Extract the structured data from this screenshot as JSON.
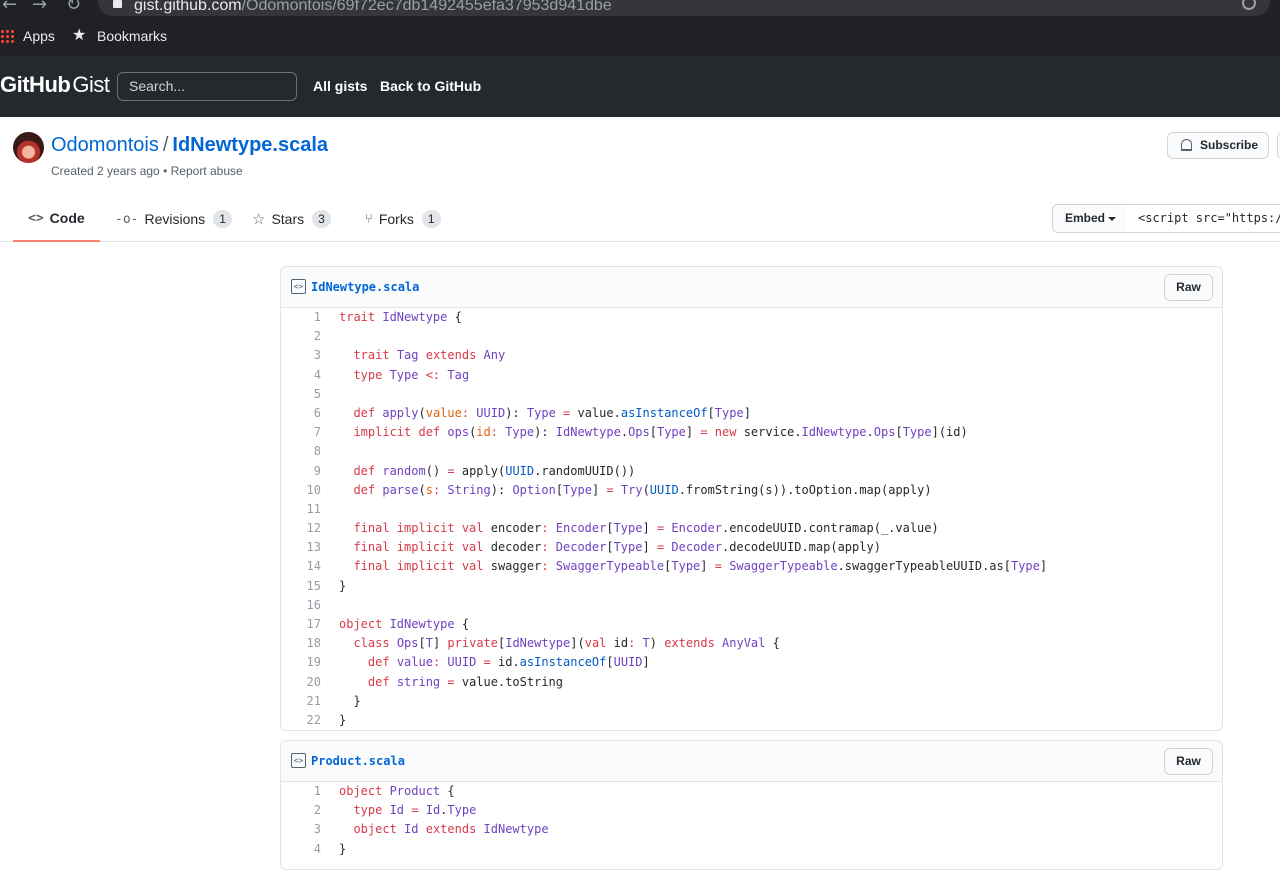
{
  "browser": {
    "url_host": "gist.github.com",
    "url_path": "/Odomontois/69f72ec7db1492455efa37953d941dbe",
    "bookmarks": {
      "apps": "Apps",
      "bookmarks": "Bookmarks"
    }
  },
  "header": {
    "logo_bold": "GitHub",
    "logo_light": "Gist",
    "search_placeholder": "Search...",
    "links": [
      "All gists",
      "Back to GitHub"
    ]
  },
  "gist": {
    "owner": "Odomontois",
    "separator": "/",
    "filename": "IdNewtype.scala",
    "created": "Created 2 years ago",
    "dot": "•",
    "report": "Report abuse",
    "subscribe": "Subscribe"
  },
  "tabs": {
    "code": "Code",
    "revisions": "Revisions",
    "revisions_count": "1",
    "stars": "Stars",
    "stars_count": "3",
    "forks": "Forks",
    "forks_count": "1",
    "embed": "Embed",
    "embed_value": "<script src=\"https://"
  },
  "files": [
    {
      "name": "IdNewtype.scala",
      "raw": "Raw",
      "lines": [
        [
          [
            "k",
            "trait "
          ],
          [
            "t",
            "IdNewtype"
          ],
          [
            "p",
            " {"
          ]
        ],
        [],
        [
          [
            "p",
            "  "
          ],
          [
            "k",
            "trait "
          ],
          [
            "t",
            "Tag "
          ],
          [
            "k",
            "extends "
          ],
          [
            "t",
            "Any"
          ]
        ],
        [
          [
            "p",
            "  "
          ],
          [
            "k",
            "type "
          ],
          [
            "t",
            "Type "
          ],
          [
            "k",
            "<: "
          ],
          [
            "t",
            "Tag"
          ]
        ],
        [],
        [
          [
            "p",
            "  "
          ],
          [
            "k",
            "def "
          ],
          [
            "t",
            "apply"
          ],
          [
            "p",
            "("
          ],
          [
            "v",
            "value"
          ],
          [
            "k",
            ": "
          ],
          [
            "t",
            "UUID"
          ],
          [
            "p",
            "): "
          ],
          [
            "t",
            "Type"
          ],
          [
            "k",
            " = "
          ],
          [
            "p",
            "value."
          ],
          [
            "c",
            "asInstanceOf"
          ],
          [
            "p",
            "["
          ],
          [
            "t",
            "Type"
          ],
          [
            "p",
            "]"
          ]
        ],
        [
          [
            "p",
            "  "
          ],
          [
            "k",
            "implicit def "
          ],
          [
            "t",
            "ops"
          ],
          [
            "p",
            "("
          ],
          [
            "v",
            "id"
          ],
          [
            "k",
            ": "
          ],
          [
            "t",
            "Type"
          ],
          [
            "p",
            "): "
          ],
          [
            "t",
            "IdNewtype"
          ],
          [
            "p",
            "."
          ],
          [
            "t",
            "Ops"
          ],
          [
            "p",
            "["
          ],
          [
            "t",
            "Type"
          ],
          [
            "p",
            "]"
          ],
          [
            "k",
            " = new "
          ],
          [
            "p",
            "service."
          ],
          [
            "t",
            "IdNewtype"
          ],
          [
            "p",
            "."
          ],
          [
            "t",
            "Ops"
          ],
          [
            "p",
            "["
          ],
          [
            "t",
            "Type"
          ],
          [
            "p",
            "](id)"
          ]
        ],
        [],
        [
          [
            "p",
            "  "
          ],
          [
            "k",
            "def "
          ],
          [
            "t",
            "random"
          ],
          [
            "p",
            "() "
          ],
          [
            "k",
            "= "
          ],
          [
            "p",
            "apply("
          ],
          [
            "c",
            "UUID"
          ],
          [
            "p",
            ".randomUUID())"
          ]
        ],
        [
          [
            "p",
            "  "
          ],
          [
            "k",
            "def "
          ],
          [
            "t",
            "parse"
          ],
          [
            "p",
            "("
          ],
          [
            "v",
            "s"
          ],
          [
            "k",
            ": "
          ],
          [
            "t",
            "String"
          ],
          [
            "p",
            "): "
          ],
          [
            "t",
            "Option"
          ],
          [
            "p",
            "["
          ],
          [
            "t",
            "Type"
          ],
          [
            "p",
            "]"
          ],
          [
            "k",
            " = "
          ],
          [
            "t",
            "Try"
          ],
          [
            "p",
            "("
          ],
          [
            "c",
            "UUID"
          ],
          [
            "p",
            ".fromString(s)).toOption.map(apply)"
          ]
        ],
        [],
        [
          [
            "p",
            "  "
          ],
          [
            "k",
            "final implicit val "
          ],
          [
            "p",
            "encoder"
          ],
          [
            "k",
            ": "
          ],
          [
            "t",
            "Encoder"
          ],
          [
            "p",
            "["
          ],
          [
            "t",
            "Type"
          ],
          [
            "p",
            "]"
          ],
          [
            "k",
            " = "
          ],
          [
            "t",
            "Encoder"
          ],
          [
            "p",
            ".encodeUUID.contramap(_.value)"
          ]
        ],
        [
          [
            "p",
            "  "
          ],
          [
            "k",
            "final implicit val "
          ],
          [
            "p",
            "decoder"
          ],
          [
            "k",
            ": "
          ],
          [
            "t",
            "Decoder"
          ],
          [
            "p",
            "["
          ],
          [
            "t",
            "Type"
          ],
          [
            "p",
            "]"
          ],
          [
            "k",
            " = "
          ],
          [
            "t",
            "Decoder"
          ],
          [
            "p",
            ".decodeUUID.map(apply)"
          ]
        ],
        [
          [
            "p",
            "  "
          ],
          [
            "k",
            "final implicit val "
          ],
          [
            "p",
            "swagger"
          ],
          [
            "k",
            ": "
          ],
          [
            "t",
            "SwaggerTypeable"
          ],
          [
            "p",
            "["
          ],
          [
            "t",
            "Type"
          ],
          [
            "p",
            "]"
          ],
          [
            "k",
            " = "
          ],
          [
            "t",
            "SwaggerTypeable"
          ],
          [
            "p",
            ".swaggerTypeableUUID.as["
          ],
          [
            "t",
            "Type"
          ],
          [
            "p",
            "]"
          ]
        ],
        [
          [
            "p",
            "}"
          ]
        ],
        [],
        [
          [
            "k",
            "object "
          ],
          [
            "t",
            "IdNewtype"
          ],
          [
            "p",
            " {"
          ]
        ],
        [
          [
            "p",
            "  "
          ],
          [
            "k",
            "class "
          ],
          [
            "t",
            "Ops"
          ],
          [
            "p",
            "["
          ],
          [
            "t",
            "T"
          ],
          [
            "p",
            "] "
          ],
          [
            "k",
            "private"
          ],
          [
            "p",
            "["
          ],
          [
            "t",
            "IdNewtype"
          ],
          [
            "p",
            "]("
          ],
          [
            "k",
            "val "
          ],
          [
            "p",
            "id"
          ],
          [
            "k",
            ": "
          ],
          [
            "t",
            "T"
          ],
          [
            "p",
            ") "
          ],
          [
            "k",
            "extends "
          ],
          [
            "t",
            "AnyVal"
          ],
          [
            "p",
            " {"
          ]
        ],
        [
          [
            "p",
            "    "
          ],
          [
            "k",
            "def "
          ],
          [
            "t",
            "value"
          ],
          [
            "k",
            ": "
          ],
          [
            "t",
            "UUID"
          ],
          [
            "k",
            " = "
          ],
          [
            "p",
            "id."
          ],
          [
            "c",
            "asInstanceOf"
          ],
          [
            "p",
            "["
          ],
          [
            "t",
            "UUID"
          ],
          [
            "p",
            "]"
          ]
        ],
        [
          [
            "p",
            "    "
          ],
          [
            "k",
            "def "
          ],
          [
            "t",
            "string"
          ],
          [
            "k",
            " = "
          ],
          [
            "p",
            "value.toString"
          ]
        ],
        [
          [
            "p",
            "  }"
          ]
        ],
        [
          [
            "p",
            "}"
          ]
        ]
      ]
    },
    {
      "name": "Product.scala",
      "raw": "Raw",
      "lines": [
        [
          [
            "k",
            "object "
          ],
          [
            "t",
            "Product"
          ],
          [
            "p",
            " {"
          ]
        ],
        [
          [
            "p",
            "  "
          ],
          [
            "k",
            "type "
          ],
          [
            "t",
            "Id"
          ],
          [
            "k",
            " = "
          ],
          [
            "t",
            "Id"
          ],
          [
            "p",
            "."
          ],
          [
            "t",
            "Type"
          ]
        ],
        [
          [
            "p",
            "  "
          ],
          [
            "k",
            "object "
          ],
          [
            "t",
            "Id "
          ],
          [
            "k",
            "extends "
          ],
          [
            "t",
            "IdNewtype"
          ]
        ],
        [
          [
            "p",
            "}"
          ]
        ]
      ]
    }
  ]
}
